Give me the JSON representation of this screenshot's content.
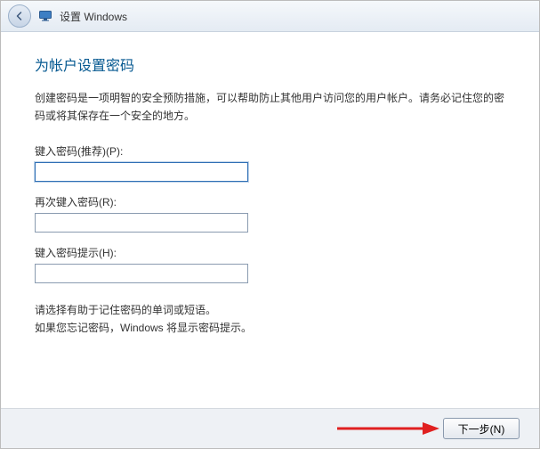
{
  "titlebar": {
    "title": "设置 Windows"
  },
  "page": {
    "heading": "为帐户设置密码",
    "description": "创建密码是一项明智的安全预防措施，可以帮助防止其他用户访问您的用户帐户。请务必记住您的密码或将其保存在一个安全的地方。"
  },
  "fields": {
    "password": {
      "label": "键入密码(推荐)(P):",
      "value": ""
    },
    "password_confirm": {
      "label": "再次键入密码(R):",
      "value": ""
    },
    "hint": {
      "label": "键入密码提示(H):",
      "value": ""
    }
  },
  "hint_text": {
    "line1": "请选择有助于记住密码的单词或短语。",
    "line2": "如果您忘记密码，Windows 将显示密码提示。"
  },
  "footer": {
    "next_label": "下一步(N)"
  }
}
